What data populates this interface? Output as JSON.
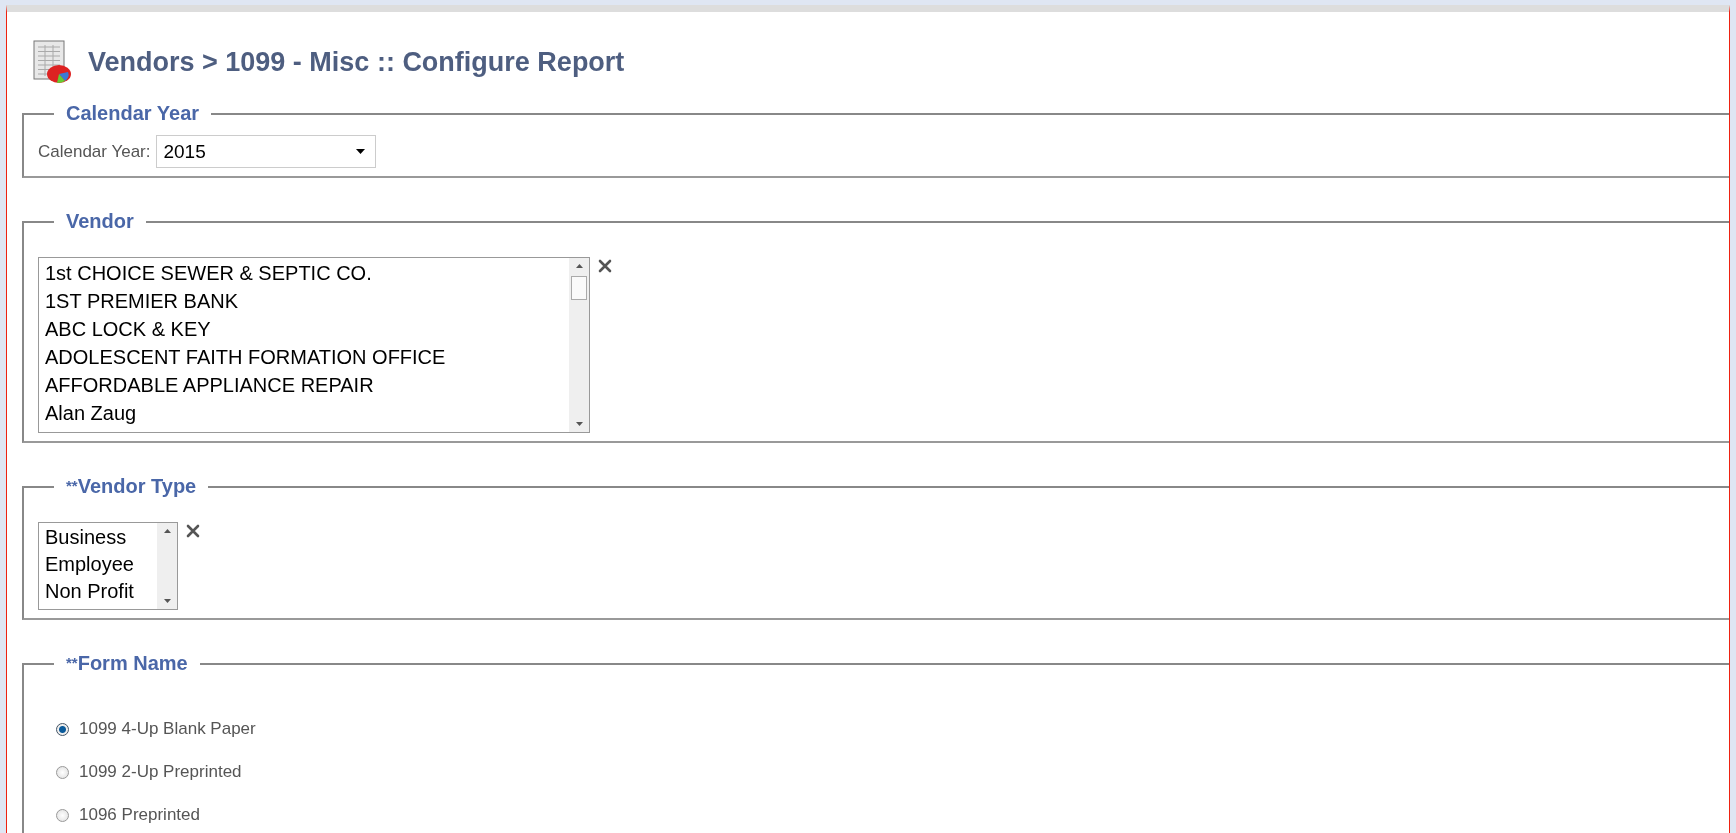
{
  "page": {
    "title": "Vendors > 1099 - Misc :: Configure Report"
  },
  "sections": [
    {
      "kind": "select",
      "legend": "Calendar Year",
      "label": "Calendar Year:",
      "value": "2015"
    },
    {
      "kind": "listbox",
      "legend": "Vendor",
      "items": [
        "1st CHOICE SEWER & SEPTIC CO.",
        "1ST PREMIER BANK",
        "ABC LOCK & KEY",
        "ADOLESCENT FAITH FORMATION OFFICE",
        "AFFORDABLE APPLIANCE REPAIR",
        "Alan Zaug"
      ]
    },
    {
      "kind": "listbox",
      "legend": "Vendor Type",
      "marker": "**",
      "items": [
        "Business",
        "Employee",
        "Non Profit"
      ]
    },
    {
      "kind": "radio",
      "legend": "Form Name",
      "marker": "**",
      "options": [
        {
          "label": "1099 4-Up Blank Paper",
          "selected": true
        },
        {
          "label": "1099 2-Up Preprinted",
          "selected": false
        },
        {
          "label": "1096 Preprinted",
          "selected": false
        }
      ]
    }
  ]
}
